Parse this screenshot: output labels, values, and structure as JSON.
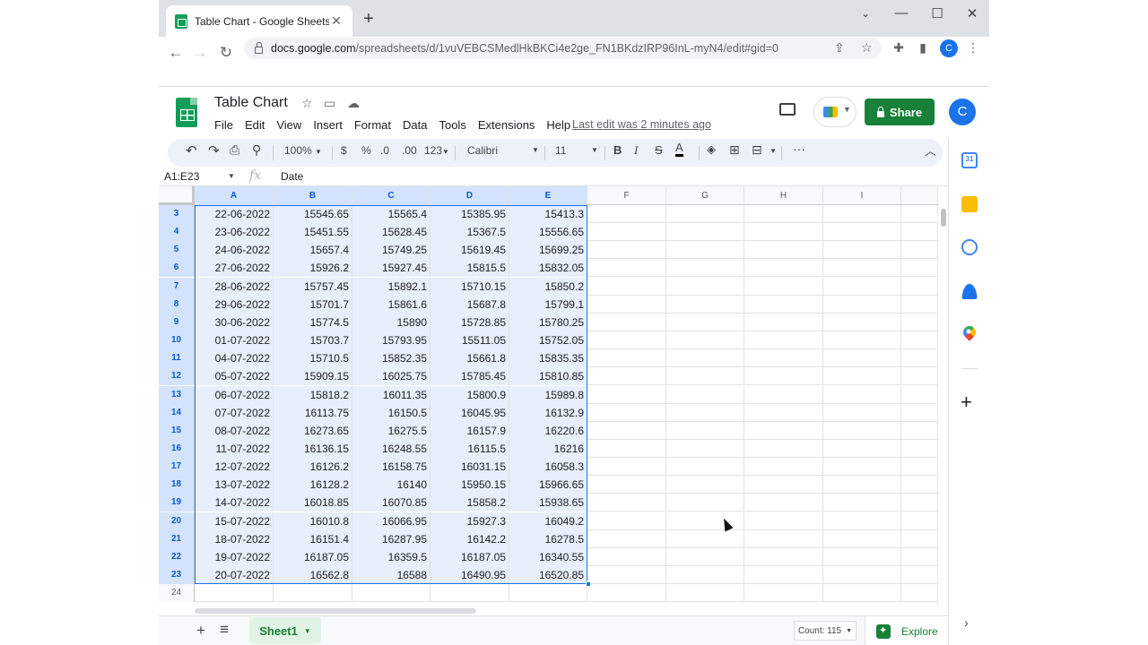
{
  "browser": {
    "tab_title": "Table Chart - Google Sheets",
    "url_domain": "docs.google.com",
    "url_path": "/spreadsheets/d/1vuVEBCSMedlHkBKCi4e2ge_FN1BKdzIRP96InL-myN4/edit#gid=0",
    "profile_initial": "C"
  },
  "doc": {
    "title": "Table Chart",
    "menu": [
      "File",
      "Edit",
      "View",
      "Insert",
      "Format",
      "Data",
      "Tools",
      "Extensions",
      "Help"
    ],
    "last_edit": "Last edit was 2 minutes ago",
    "share_label": "Share",
    "avatar_initial": "C"
  },
  "toolbar": {
    "zoom": "100%",
    "currency": "$",
    "percent": "%",
    "dec_dec": ".0",
    "dec_inc": ".00",
    "more_formats": "123",
    "font": "Calibri",
    "font_size": "11"
  },
  "formula_bar": {
    "name_box": "A1:E23",
    "fx": "fx",
    "value": "Date"
  },
  "columns": [
    "A",
    "B",
    "C",
    "D",
    "E",
    "F",
    "G",
    "H",
    "I"
  ],
  "rows": [
    {
      "n": "3",
      "cells": [
        "22-06-2022",
        "15545.65",
        "15565.4",
        "15385.95",
        "15413.3"
      ]
    },
    {
      "n": "4",
      "cells": [
        "23-06-2022",
        "15451.55",
        "15628.45",
        "15367.5",
        "15556.65"
      ]
    },
    {
      "n": "5",
      "cells": [
        "24-06-2022",
        "15657.4",
        "15749.25",
        "15619.45",
        "15699.25"
      ]
    },
    {
      "n": "6",
      "cells": [
        "27-06-2022",
        "15926.2",
        "15927.45",
        "15815.5",
        "15832.05"
      ]
    },
    {
      "n": "7",
      "cells": [
        "28-06-2022",
        "15757.45",
        "15892.1",
        "15710.15",
        "15850.2"
      ]
    },
    {
      "n": "8",
      "cells": [
        "29-06-2022",
        "15701.7",
        "15861.6",
        "15687.8",
        "15799.1"
      ]
    },
    {
      "n": "9",
      "cells": [
        "30-06-2022",
        "15774.5",
        "15890",
        "15728.85",
        "15780.25"
      ]
    },
    {
      "n": "10",
      "cells": [
        "01-07-2022",
        "15703.7",
        "15793.95",
        "15511.05",
        "15752.05"
      ]
    },
    {
      "n": "11",
      "cells": [
        "04-07-2022",
        "15710.5",
        "15852.35",
        "15661.8",
        "15835.35"
      ]
    },
    {
      "n": "12",
      "cells": [
        "05-07-2022",
        "15909.15",
        "16025.75",
        "15785.45",
        "15810.85"
      ]
    },
    {
      "n": "13",
      "cells": [
        "06-07-2022",
        "15818.2",
        "16011.35",
        "15800.9",
        "15989.8"
      ]
    },
    {
      "n": "14",
      "cells": [
        "07-07-2022",
        "16113.75",
        "16150.5",
        "16045.95",
        "16132.9"
      ]
    },
    {
      "n": "15",
      "cells": [
        "08-07-2022",
        "16273.65",
        "16275.5",
        "16157.9",
        "16220.6"
      ]
    },
    {
      "n": "16",
      "cells": [
        "11-07-2022",
        "16136.15",
        "16248.55",
        "16115.5",
        "16216"
      ]
    },
    {
      "n": "17",
      "cells": [
        "12-07-2022",
        "16126.2",
        "16158.75",
        "16031.15",
        "16058.3"
      ]
    },
    {
      "n": "18",
      "cells": [
        "13-07-2022",
        "16128.2",
        "16140",
        "15950.15",
        "15966.65"
      ]
    },
    {
      "n": "19",
      "cells": [
        "14-07-2022",
        "16018.85",
        "16070.85",
        "15858.2",
        "15938.65"
      ]
    },
    {
      "n": "20",
      "cells": [
        "15-07-2022",
        "16010.8",
        "16066.95",
        "15927.3",
        "16049.2"
      ]
    },
    {
      "n": "21",
      "cells": [
        "18-07-2022",
        "16151.4",
        "16287.95",
        "16142.2",
        "16278.5"
      ]
    },
    {
      "n": "22",
      "cells": [
        "19-07-2022",
        "16187.05",
        "16359.5",
        "16187.05",
        "16340.55"
      ]
    },
    {
      "n": "23",
      "cells": [
        "20-07-2022",
        "16562.8",
        "16588",
        "16490.95",
        "16520.85"
      ]
    },
    {
      "n": "24",
      "cells": [
        "",
        "",
        "",
        "",
        ""
      ]
    }
  ],
  "bottom": {
    "sheet_name": "Sheet1",
    "count": "Count: 115",
    "explore": "Explore"
  }
}
